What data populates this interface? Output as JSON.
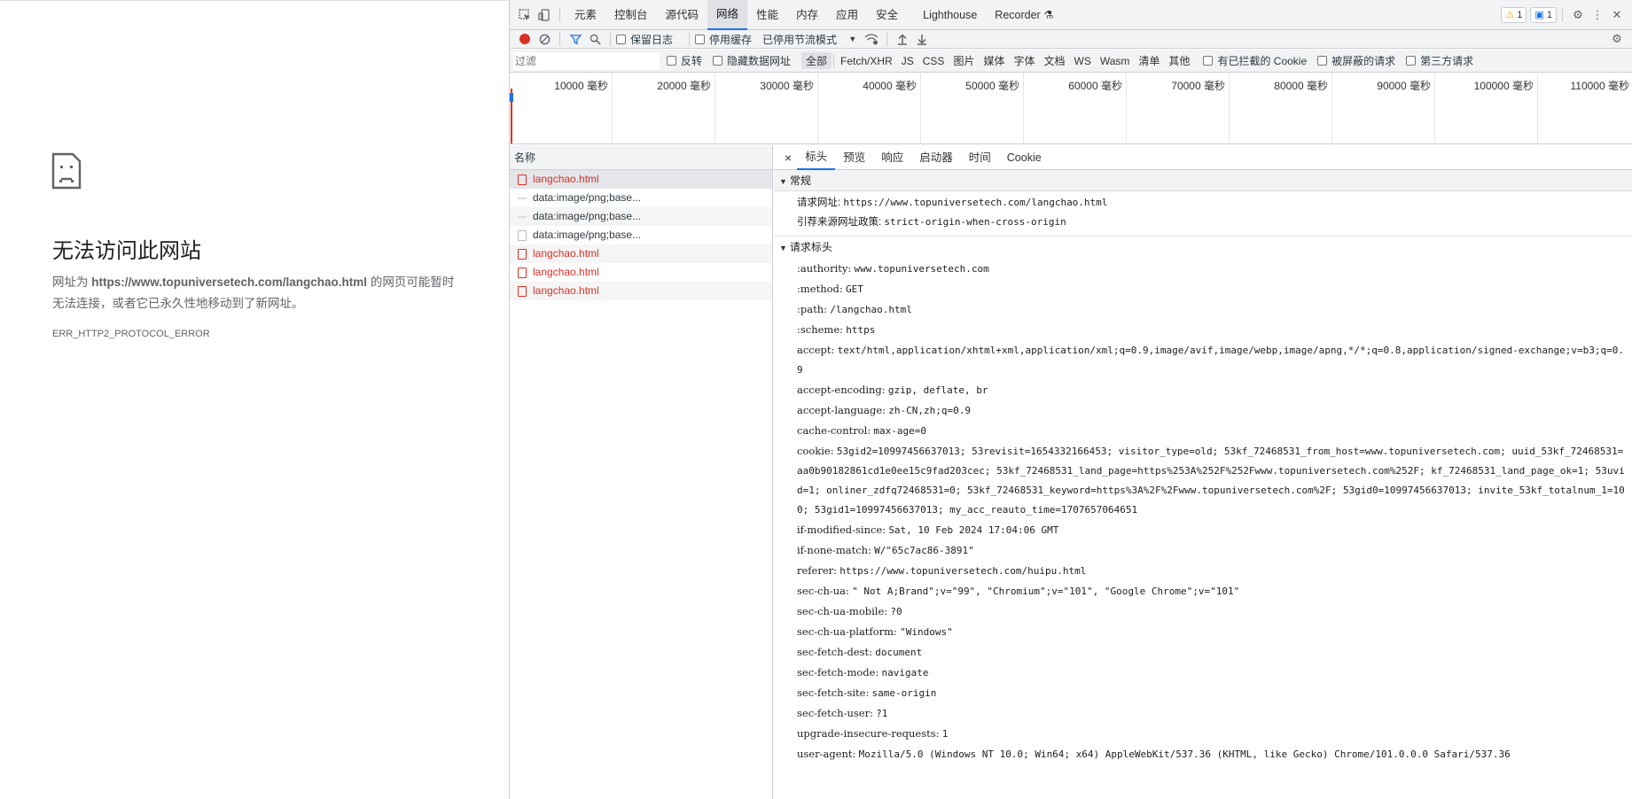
{
  "error_page": {
    "title": "无法访问此网站",
    "desc_prefix": "网址为 ",
    "url": "https://www.topuniversetech.com/langchao.html",
    "desc_suffix": " 的网页可能暂时无法连接，或者它已永久性地移动到了新网址。",
    "error_code": "ERR_HTTP2_PROTOCOL_ERROR"
  },
  "devtools": {
    "tabs": [
      "元素",
      "控制台",
      "源代码",
      "网络",
      "性能",
      "内存",
      "应用",
      "安全",
      "Lighthouse",
      "Recorder"
    ],
    "active_tab": "网络",
    "warnings_count": "1",
    "messages_count": "1",
    "toolbar": {
      "preserve_log": "保留日志",
      "disable_cache": "停用缓存",
      "throttling": "已停用节流模式"
    },
    "filter": {
      "placeholder": "过滤",
      "invert": "反转",
      "hide_data_urls": "隐藏数据网址",
      "types": [
        "全部",
        "Fetch/XHR",
        "JS",
        "CSS",
        "图片",
        "媒体",
        "字体",
        "文档",
        "WS",
        "Wasm",
        "清单",
        "其他"
      ],
      "active_type": "全部",
      "blocked_cookies": "有已拦截的 Cookie",
      "blocked_requests": "被屏蔽的请求",
      "third_party": "第三方请求"
    },
    "timeline_ticks": [
      "10000 毫秒",
      "20000 毫秒",
      "30000 毫秒",
      "40000 毫秒",
      "50000 毫秒",
      "60000 毫秒",
      "70000 毫秒",
      "80000 毫秒",
      "90000 毫秒",
      "100000 毫秒",
      "110000 毫秒"
    ],
    "request_list": {
      "header": "名称",
      "rows": [
        {
          "name": "langchao.html",
          "type": "err"
        },
        {
          "name": "data:image/png;base...",
          "type": "img"
        },
        {
          "name": "data:image/png;base...",
          "type": "img"
        },
        {
          "name": "data:image/png;base...",
          "type": "doc"
        },
        {
          "name": "langchao.html",
          "type": "err"
        },
        {
          "name": "langchao.html",
          "type": "err"
        },
        {
          "name": "langchao.html",
          "type": "err"
        }
      ]
    },
    "details": {
      "close": "×",
      "tabs": [
        "标头",
        "预览",
        "响应",
        "启动器",
        "时间",
        "Cookie"
      ],
      "active_tab": "标头",
      "general_title": "常规",
      "general": [
        {
          "k": "请求网址:",
          "v": "https://www.topuniversetech.com/langchao.html"
        },
        {
          "k": "引荐来源网址政策:",
          "v": "strict-origin-when-cross-origin"
        }
      ],
      "request_headers_title": "请求标头",
      "request_headers": [
        {
          "k": ":authority:",
          "v": "www.topuniversetech.com"
        },
        {
          "k": ":method:",
          "v": "GET"
        },
        {
          "k": ":path:",
          "v": "/langchao.html"
        },
        {
          "k": ":scheme:",
          "v": "https"
        },
        {
          "k": "accept:",
          "v": "text/html,application/xhtml+xml,application/xml;q=0.9,image/avif,image/webp,image/apng,*/*;q=0.8,application/signed-exchange;v=b3;q=0.9"
        },
        {
          "k": "accept-encoding:",
          "v": "gzip, deflate, br"
        },
        {
          "k": "accept-language:",
          "v": "zh-CN,zh;q=0.9"
        },
        {
          "k": "cache-control:",
          "v": "max-age=0"
        },
        {
          "k": "cookie:",
          "v": "53gid2=10997456637013; 53revisit=1654332166453; visitor_type=old; 53kf_72468531_from_host=www.topuniversetech.com; uuid_53kf_72468531=aa0b90182861cd1e0ee15c9fad203cec; 53kf_72468531_land_page=https%253A%252F%252Fwww.topuniversetech.com%252F; kf_72468531_land_page_ok=1; 53uvid=1; onliner_zdfq72468531=0; 53kf_72468531_keyword=https%3A%2F%2Fwww.topuniversetech.com%2F; 53gid0=10997456637013; invite_53kf_totalnum_1=100; 53gid1=10997456637013; my_acc_reauto_time=1707657064651"
        },
        {
          "k": "if-modified-since:",
          "v": "Sat, 10 Feb 2024 17:04:06 GMT"
        },
        {
          "k": "if-none-match:",
          "v": "W/\"65c7ac86-3891\""
        },
        {
          "k": "referer:",
          "v": "https://www.topuniversetech.com/huipu.html"
        },
        {
          "k": "sec-ch-ua:",
          "v": "\" Not A;Brand\";v=\"99\", \"Chromium\";v=\"101\", \"Google Chrome\";v=\"101\""
        },
        {
          "k": "sec-ch-ua-mobile:",
          "v": "?0"
        },
        {
          "k": "sec-ch-ua-platform:",
          "v": "\"Windows\""
        },
        {
          "k": "sec-fetch-dest:",
          "v": "document"
        },
        {
          "k": "sec-fetch-mode:",
          "v": "navigate"
        },
        {
          "k": "sec-fetch-site:",
          "v": "same-origin"
        },
        {
          "k": "sec-fetch-user:",
          "v": "?1"
        },
        {
          "k": "upgrade-insecure-requests:",
          "v": "1"
        },
        {
          "k": "user-agent:",
          "v": "Mozilla/5.0 (Windows NT 10.0; Win64; x64) AppleWebKit/537.36 (KHTML, like Gecko) Chrome/101.0.0.0 Safari/537.36"
        }
      ]
    }
  },
  "colors": {
    "error_red": "#d93025",
    "accent_blue": "#1a73e8",
    "warning_yellow": "#f9ab00"
  }
}
